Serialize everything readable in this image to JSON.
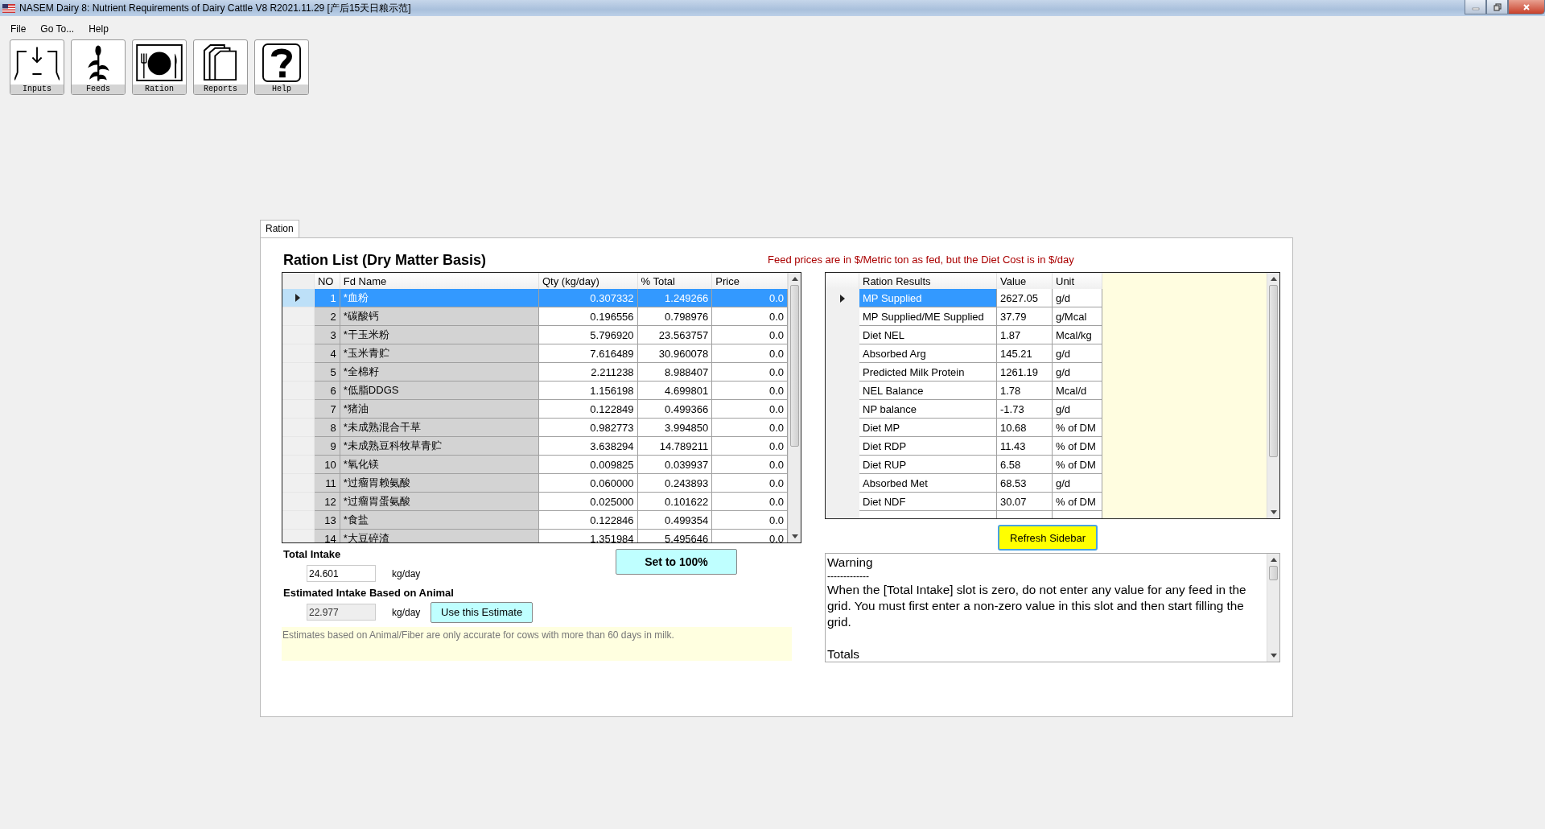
{
  "window": {
    "title": "NASEM Dairy 8: Nutrient Requirements of Dairy Cattle  V8 R2021.11.29 [产后15天日粮示范]"
  },
  "menu": [
    "File",
    "Go To...",
    "Help"
  ],
  "toolbar": [
    {
      "label": "Inputs",
      "kind": "inputs"
    },
    {
      "label": "Feeds",
      "kind": "feeds"
    },
    {
      "label": "Ration",
      "kind": "ration"
    },
    {
      "label": "Reports",
      "kind": "reports"
    },
    {
      "label": "Help",
      "kind": "help"
    }
  ],
  "tab": {
    "label": "Ration",
    "selected": true
  },
  "ration_list": {
    "title": "Ration List (Dry Matter Basis)",
    "columns": [
      "NO",
      "Fd  Name",
      "Qty (kg/day)",
      "% Total",
      "Price"
    ],
    "rows": [
      {
        "no": "1",
        "name": "*血粉",
        "qty": "0.307332",
        "total": "1.249266",
        "price": "0.0",
        "selected": true
      },
      {
        "no": "2",
        "name": "*碳酸钙",
        "qty": "0.196556",
        "total": "0.798976",
        "price": "0.0",
        "selected": false
      },
      {
        "no": "3",
        "name": "*干玉米粉",
        "qty": "5.796920",
        "total": "23.563757",
        "price": "0.0",
        "selected": false
      },
      {
        "no": "4",
        "name": "*玉米青贮",
        "qty": "7.616489",
        "total": "30.960078",
        "price": "0.0",
        "selected": false
      },
      {
        "no": "5",
        "name": "*全棉籽",
        "qty": "2.211238",
        "total": "8.988407",
        "price": "0.0",
        "selected": false
      },
      {
        "no": "6",
        "name": "*低脂DDGS",
        "qty": "1.156198",
        "total": "4.699801",
        "price": "0.0",
        "selected": false
      },
      {
        "no": "7",
        "name": "*猪油",
        "qty": "0.122849",
        "total": "0.499366",
        "price": "0.0",
        "selected": false
      },
      {
        "no": "8",
        "name": "*未成熟混合干草",
        "qty": "0.982773",
        "total": "3.994850",
        "price": "0.0",
        "selected": false
      },
      {
        "no": "9",
        "name": "*未成熟豆科牧草青贮",
        "qty": "3.638294",
        "total": "14.789211",
        "price": "0.0",
        "selected": false
      },
      {
        "no": "10",
        "name": "*氧化镁",
        "qty": "0.009825",
        "total": "0.039937",
        "price": "0.0",
        "selected": false
      },
      {
        "no": "11",
        "name": "*过瘤胃赖氨酸",
        "qty": "0.060000",
        "total": "0.243893",
        "price": "0.0",
        "selected": false
      },
      {
        "no": "12",
        "name": "*过瘤胃蛋氨酸",
        "qty": "0.025000",
        "total": "0.101622",
        "price": "0.0",
        "selected": false
      },
      {
        "no": "13",
        "name": "*食盐",
        "qty": "0.122846",
        "total": "0.499354",
        "price": "0.0",
        "selected": false
      },
      {
        "no": "14",
        "name": "*大豆碎渣",
        "qty": "1.351984",
        "total": "5.495646",
        "price": "0.0",
        "selected": false
      }
    ]
  },
  "price_note": "Feed prices are in $/Metric ton as fed, but the Diet Cost is in $/day",
  "total_intake": {
    "label": "Total Intake",
    "value": "24.601",
    "unit": "kg/day",
    "disabled": false
  },
  "set_button": "Set to 100%",
  "estimated_intake": {
    "label": "Estimated Intake Based on Animal",
    "value": "22.977",
    "unit": "kg/day",
    "disabled": true,
    "button": "Use this Estimate"
  },
  "estimate_note": "Estimates based on Animal/Fiber are only accurate for cows with more than 60 days in milk.",
  "results": {
    "columns": [
      "Ration Results",
      "Value",
      "Unit"
    ],
    "rows": [
      {
        "name": "MP Supplied",
        "value": "2627.05",
        "unit": "g/d",
        "selected": true
      },
      {
        "name": "MP Supplied/ME Supplied",
        "value": "37.79",
        "unit": "g/Mcal",
        "selected": false
      },
      {
        "name": "Diet NEL",
        "value": "1.87",
        "unit": "Mcal/kg",
        "selected": false
      },
      {
        "name": "Absorbed Arg",
        "value": "145.21",
        "unit": "g/d",
        "selected": false
      },
      {
        "name": "Predicted Milk Protein",
        "value": "1261.19",
        "unit": "g/d",
        "selected": false
      },
      {
        "name": "NEL Balance",
        "value": "1.78",
        "unit": "Mcal/d",
        "selected": false
      },
      {
        "name": "NP balance",
        "value": "-1.73",
        "unit": "g/d",
        "selected": false
      },
      {
        "name": "Diet MP",
        "value": "10.68",
        "unit": "% of DM",
        "selected": false
      },
      {
        "name": "Diet RDP",
        "value": "11.43",
        "unit": "% of DM",
        "selected": false
      },
      {
        "name": "Diet RUP",
        "value": "6.58",
        "unit": "% of DM",
        "selected": false
      },
      {
        "name": "Absorbed Met",
        "value": "68.53",
        "unit": "g/d",
        "selected": false
      },
      {
        "name": "Diet NDF",
        "value": "30.07",
        "unit": "% of DM",
        "selected": false
      }
    ]
  },
  "refresh_button": "Refresh Sidebar",
  "messages": [
    {
      "kind": "heading",
      "text": "Warning"
    },
    {
      "kind": "rule",
      "text": "-------------"
    },
    {
      "kind": "paragraph",
      "text": "When the [Total Intake] slot is zero, do not enter any value for any feed in the grid. You must first enter a non-zero value in this slot and then start filling the grid."
    },
    {
      "kind": "heading",
      "text": "Totals"
    }
  ]
}
